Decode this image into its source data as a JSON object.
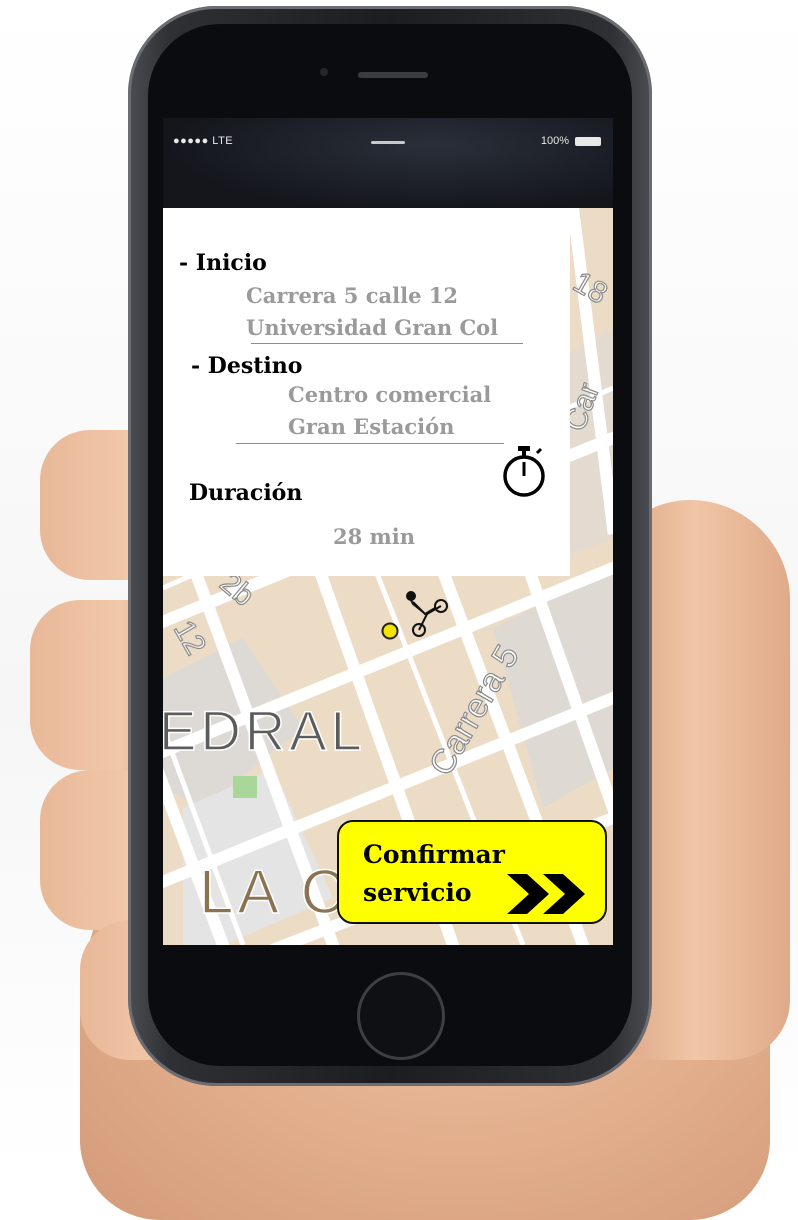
{
  "status_bar": {
    "carrier": "●●●●● LTE",
    "battery": "100%"
  },
  "trip": {
    "start_label": "- Inicio",
    "start_address_line1": "Carrera 5 calle 12",
    "start_address_line2": "Universidad Gran Col",
    "destination_label": "- Destino",
    "destination_line1": "Centro comercial",
    "destination_line2": "Gran Estación",
    "duration_label": "Duración",
    "duration_value": "28 min"
  },
  "map": {
    "street_labels": [
      "18",
      "Car",
      "2b",
      "12",
      "Carrera 5",
      "EDRAL",
      "LA C"
    ]
  },
  "confirm_button": {
    "line1": "Confirmar",
    "line2": "servicio",
    "icon": "double-chevron-right-icon"
  },
  "icons": {
    "timer": "stopwatch-icon",
    "rider": "motorcycle-rider-icon",
    "location": "location-dot-icon"
  },
  "colors": {
    "accent": "#ffff00",
    "location_dot": "#f5e400",
    "map_base": "#ecdcc6",
    "road": "#ffffff",
    "secondary_text": "#9a9a9a"
  }
}
